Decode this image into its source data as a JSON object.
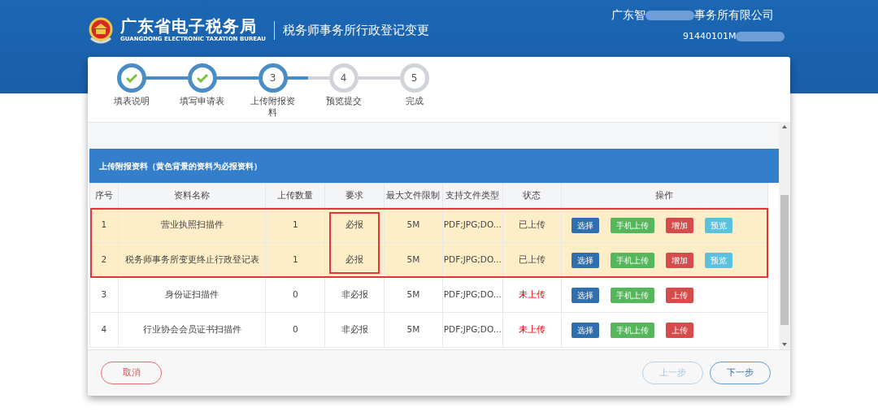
{
  "header": {
    "title": "广东省电子税务局",
    "subtitle": "GUANGDONG ELECTRONIC TAXATION BUREAU",
    "page_title": "税务师事务所行政登记变更",
    "company_name_start": "广东智",
    "company_name_end": "事务所有限公司",
    "tax_id": "91440101M"
  },
  "steps": [
    {
      "label": "填表说明",
      "kind": "done"
    },
    {
      "label": "填写申请表",
      "kind": "done"
    },
    {
      "number": "3",
      "label": "上传附报资料",
      "kind": "current"
    },
    {
      "number": "4",
      "label": "预览提交",
      "kind": "pending"
    },
    {
      "number": "5",
      "label": "完成",
      "kind": "pending"
    }
  ],
  "section_title": "上传附报资料（黄色背景的资料为必报资料）",
  "table": {
    "columns": [
      "序号",
      "资料名称",
      "上传数量",
      "要求",
      "最大文件限制",
      "支持文件类型",
      "状态",
      "操作"
    ],
    "rows": [
      {
        "index": "1",
        "name": "营业执照扫描件",
        "count": "1",
        "requirement": "必报",
        "required": true,
        "max_size": "5M",
        "types": "PDF;JPG;DO...",
        "status": "已上传",
        "uploaded": true,
        "outlined": true,
        "requirement_outlined": true,
        "actions": [
          {
            "label": "选择",
            "kind": "choose"
          },
          {
            "label": "手机上传",
            "kind": "mobile"
          },
          {
            "label": "增加",
            "kind": "add"
          },
          {
            "label": "预览",
            "kind": "preview"
          }
        ]
      },
      {
        "index": "2",
        "name": "税务师事务所变更终止行政登记表",
        "count": "1",
        "requirement": "必报",
        "required": true,
        "max_size": "5M",
        "types": "PDF;JPG;DO...",
        "status": "已上传",
        "uploaded": true,
        "outlined": true,
        "requirement_outlined": true,
        "actions": [
          {
            "label": "选择",
            "kind": "choose"
          },
          {
            "label": "手机上传",
            "kind": "mobile"
          },
          {
            "label": "增加",
            "kind": "add"
          },
          {
            "label": "预览",
            "kind": "preview"
          }
        ]
      },
      {
        "index": "3",
        "name": "身份证扫描件",
        "count": "0",
        "requirement": "非必报",
        "required": false,
        "max_size": "5M",
        "types": "PDF;JPG;DO...",
        "status": "未上传",
        "uploaded": false,
        "outlined": false,
        "requirement_outlined": false,
        "actions": [
          {
            "label": "选择",
            "kind": "choose"
          },
          {
            "label": "手机上传",
            "kind": "mobile"
          },
          {
            "label": "上传",
            "kind": "add"
          }
        ]
      },
      {
        "index": "4",
        "name": "行业协会会员证书扫描件",
        "count": "0",
        "requirement": "非必报",
        "required": false,
        "max_size": "5M",
        "types": "PDF;JPG;DO...",
        "status": "未上传",
        "uploaded": false,
        "outlined": false,
        "requirement_outlined": false,
        "actions": [
          {
            "label": "选择",
            "kind": "choose"
          },
          {
            "label": "手机上传",
            "kind": "mobile"
          },
          {
            "label": "上传",
            "kind": "add"
          }
        ]
      }
    ]
  },
  "footer": {
    "cancel": "取消",
    "prev": {
      "label": "上一步",
      "disabled": true
    },
    "next": {
      "label": "下一步",
      "disabled": false
    }
  }
}
